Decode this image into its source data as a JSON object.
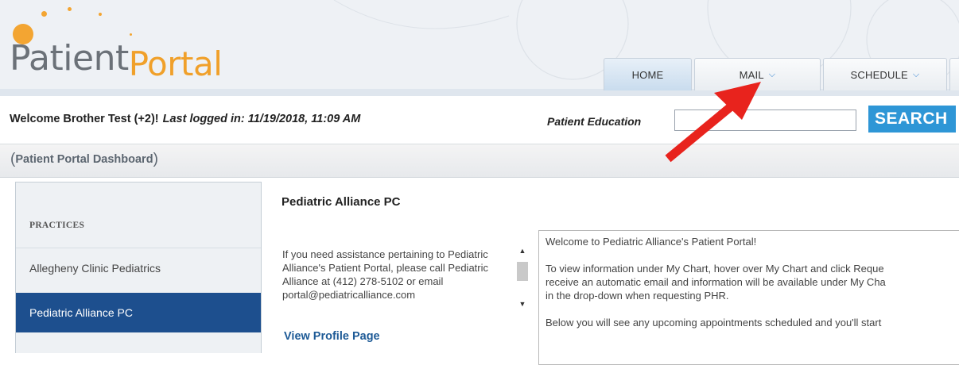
{
  "app": {
    "logo_part1": "Patient",
    "logo_part2": "Portal"
  },
  "nav": {
    "tabs": [
      {
        "label": "HOME",
        "has_dropdown": false
      },
      {
        "label": "MAIL",
        "has_dropdown": true
      },
      {
        "label": "SCHEDULE",
        "has_dropdown": true
      }
    ],
    "dropdown_icon": "chevron-down-icon"
  },
  "welcome": {
    "greeting": "Welcome Brother Test (+2)!",
    "last_login": "Last logged in: 11/19/2018, 11:09 AM"
  },
  "search": {
    "label": "Patient Education",
    "value": "",
    "button_label": "SEARCH"
  },
  "breadcrumb": {
    "open": "(",
    "label": "Patient Portal Dashboard",
    "close": ")"
  },
  "sidebar": {
    "heading": "PRACTICES",
    "items": [
      {
        "label": "Allegheny Clinic Pediatrics",
        "active": false
      },
      {
        "label": "Pediatric Alliance PC",
        "active": true
      }
    ]
  },
  "practice": {
    "title": "Pediatric Alliance PC",
    "assistance_text": "If you need assistance pertaining to Pediatric Alliance's Patient Portal, please call Pediatric Alliance at (412) 278-5102 or email portal@pediatricalliance.com",
    "profile_link": "View Profile Page",
    "welcome_lines": [
      "Welcome to Pediatric Alliance's Patient Portal!",
      "To view information under My Chart, hover over My Chart and click Reque",
      "receive an automatic email and information will be available under My Cha",
      "in the drop-down when requesting PHR.",
      "Below you will see any upcoming appointments scheduled and you'll start"
    ]
  },
  "colors": {
    "search_button": "#2e96d6",
    "active_sidebar": "#1d4f8e",
    "accent_orange": "#f0a02a",
    "link_blue": "#1d5a96",
    "annotation_arrow": "#e8231d"
  }
}
